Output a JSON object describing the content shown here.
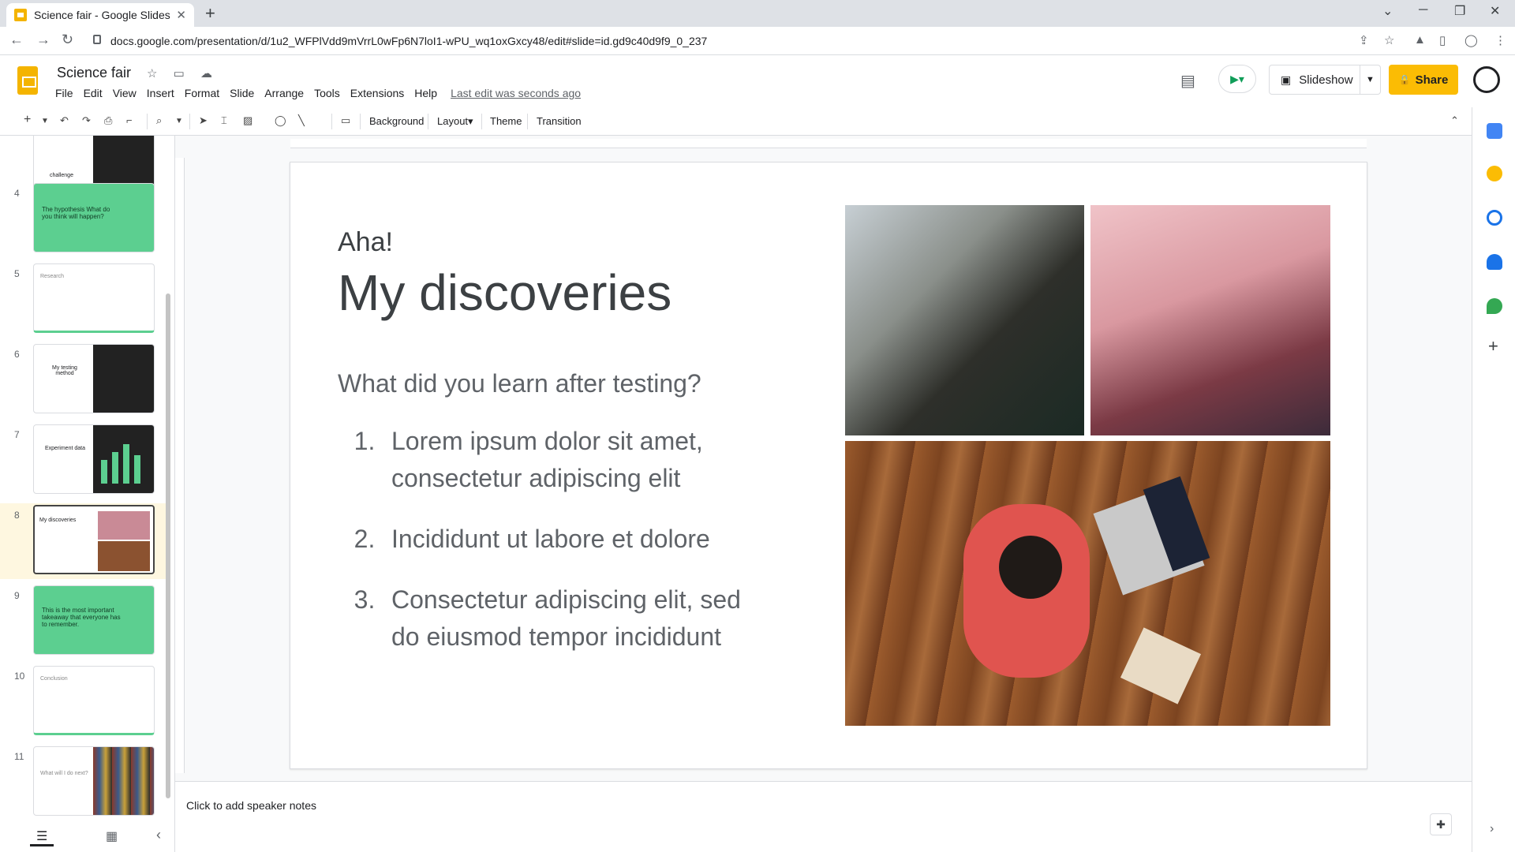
{
  "browser": {
    "tab_title": "Science fair - Google Slides",
    "url": "docs.google.com/presentation/d/1u2_WFPlVdd9mVrrL0wFp6N7loI1-wPU_wq1oxGxcy48/edit#slide=id.gd9c40d9f9_0_237"
  },
  "header": {
    "doc_title": "Science fair",
    "menu": [
      "File",
      "Edit",
      "View",
      "Insert",
      "Format",
      "Slide",
      "Arrange",
      "Tools",
      "Extensions",
      "Help"
    ],
    "last_edit": "Last edit was seconds ago",
    "slideshow_label": "Slideshow",
    "share_label": "Share"
  },
  "toolbar": {
    "background": "Background",
    "layout": "Layout▾",
    "theme": "Theme",
    "transition": "Transition"
  },
  "filmstrip": {
    "slides": [
      {
        "num": "",
        "text": "challenge"
      },
      {
        "num": "4",
        "text": "The hypothesis What do you think will happen?"
      },
      {
        "num": "5",
        "text": "Research"
      },
      {
        "num": "6",
        "text": "My testing method"
      },
      {
        "num": "7",
        "text": "Experiment data"
      },
      {
        "num": "8",
        "text": "My discoveries"
      },
      {
        "num": "9",
        "text": "This is the most important takeaway that everyone has to remember."
      },
      {
        "num": "10",
        "text": "Conclusion"
      },
      {
        "num": "11",
        "text": "What will I do next?"
      }
    ]
  },
  "slide": {
    "kicker": "Aha!",
    "title": "My discoveries",
    "question": "What did you learn after testing?",
    "items": [
      {
        "n": "1.",
        "text": "Lorem ipsum dolor sit amet, consectetur adipiscing elit"
      },
      {
        "n": "2.",
        "text": "Incididunt ut labore et dolore"
      },
      {
        "n": "3.",
        "text": "Consectetur adipiscing elit, sed do eiusmod tempor incididunt"
      }
    ]
  },
  "notes": {
    "placeholder": "Click to add speaker notes"
  },
  "colors": {
    "accent_yellow": "#fbbc04",
    "thumb_green": "#5ccf90"
  }
}
